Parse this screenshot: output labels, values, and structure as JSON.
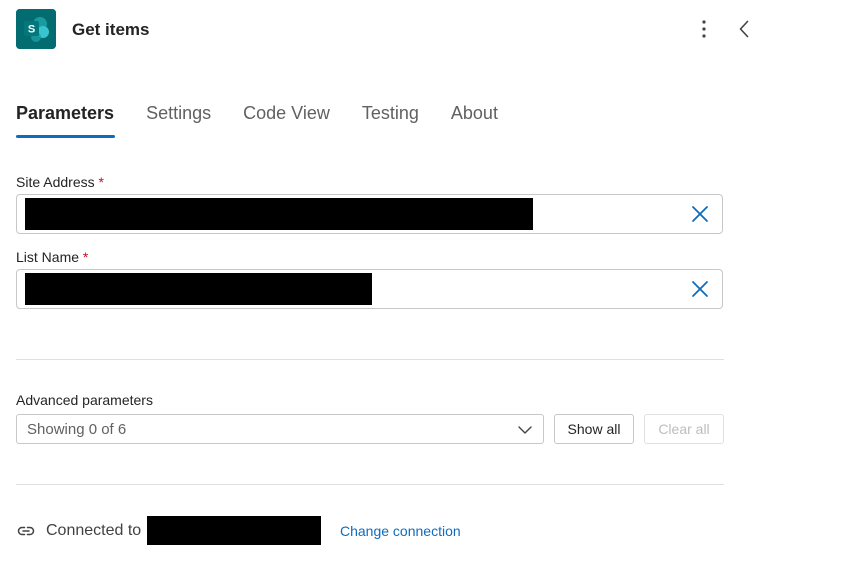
{
  "header": {
    "title": "Get items",
    "icon": "sharepoint-icon",
    "brand_color": "#036c70"
  },
  "tabs": [
    {
      "label": "Parameters",
      "active": true
    },
    {
      "label": "Settings",
      "active": false
    },
    {
      "label": "Code View",
      "active": false
    },
    {
      "label": "Testing",
      "active": false
    },
    {
      "label": "About",
      "active": false
    }
  ],
  "fields": {
    "site_address": {
      "label": "Site Address",
      "required_mark": "*",
      "value": ""
    },
    "list_name": {
      "label": "List Name",
      "required_mark": "*",
      "value": ""
    }
  },
  "advanced": {
    "label": "Advanced parameters",
    "dropdown_value": "Showing 0 of 6",
    "show_all_label": "Show all",
    "clear_all_label": "Clear all"
  },
  "connection": {
    "text": "Connected to",
    "change_label": "Change connection",
    "link_color": "#0f6cbd"
  }
}
